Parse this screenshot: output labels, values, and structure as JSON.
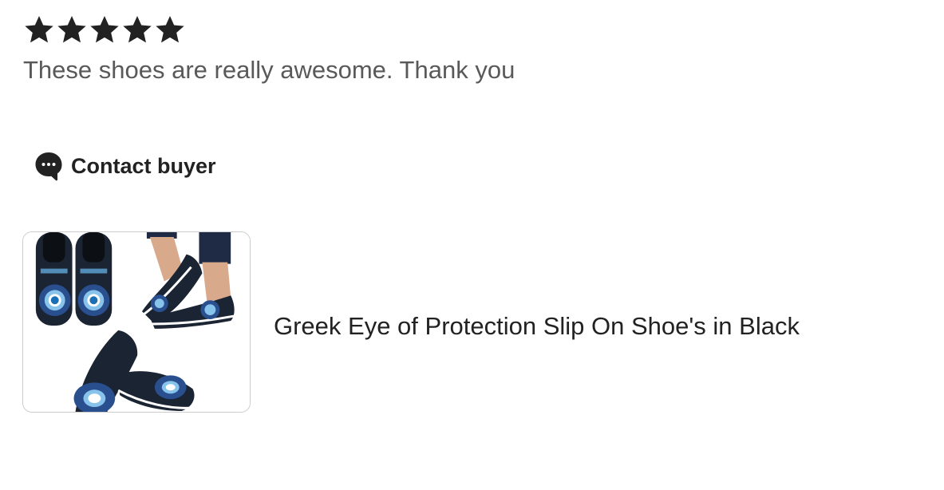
{
  "review": {
    "rating": 5,
    "max_rating": 5,
    "text": "These shoes are really awesome. Thank you"
  },
  "contact": {
    "label": "Contact buyer",
    "icon": "chat-bubble-icon"
  },
  "product": {
    "title": "Greek Eye of Protection Slip On Shoe's in Black",
    "image_icon": "product-image"
  },
  "colors": {
    "star": "#222222",
    "review_text": "#595959",
    "title_text": "#222222",
    "thumb_border": "#cccccc"
  }
}
